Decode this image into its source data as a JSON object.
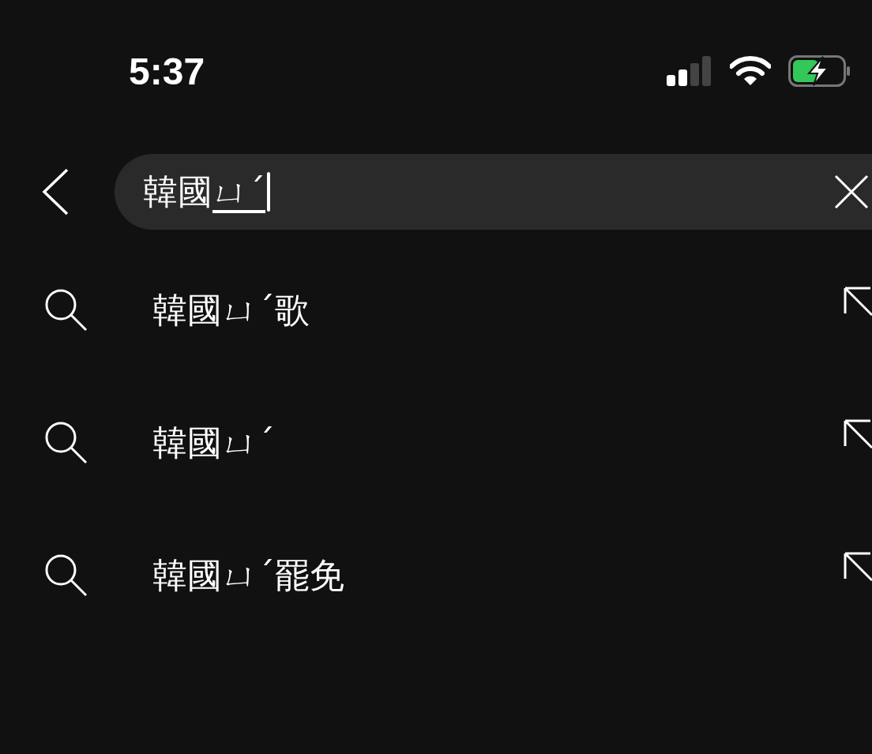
{
  "status_bar": {
    "time": "5:37"
  },
  "search": {
    "value": "韓國",
    "composing": "ㄩˊ"
  },
  "suggestions": [
    {
      "text": "韓國ㄩˊ歌"
    },
    {
      "text": "韓國ㄩˊ"
    },
    {
      "text": "韓國ㄩˊ罷免"
    }
  ]
}
